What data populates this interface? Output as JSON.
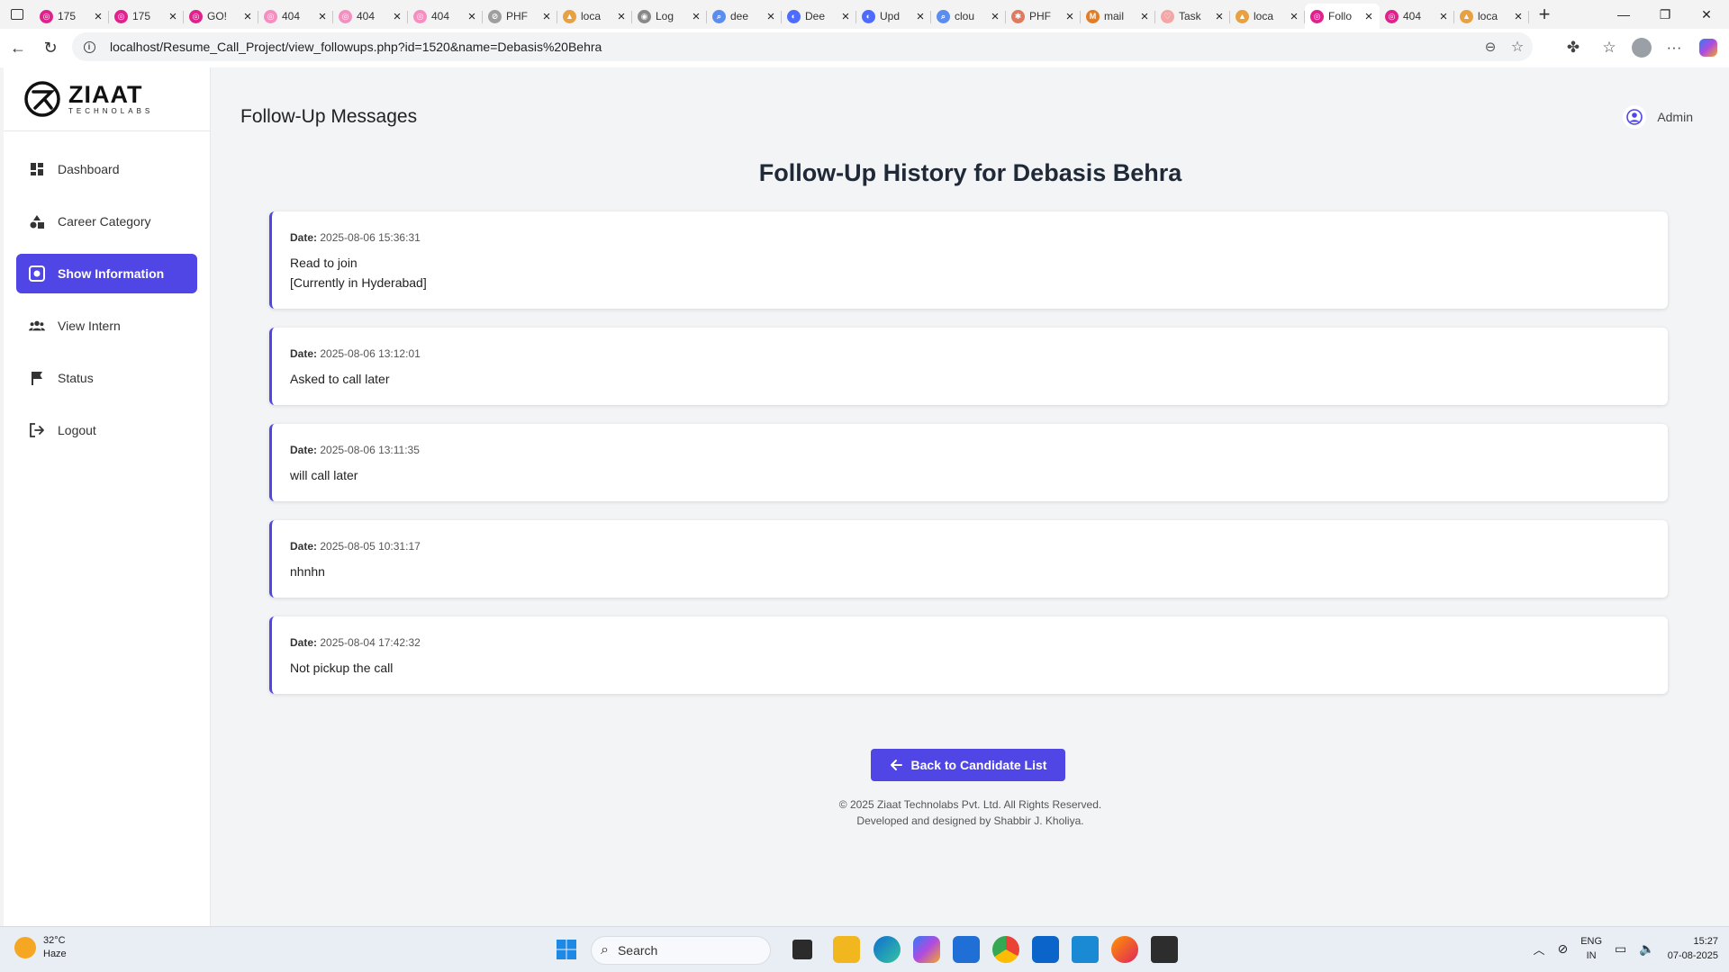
{
  "browser": {
    "tabs": [
      {
        "title": "175",
        "color": "#e0238c",
        "glyph": "◎"
      },
      {
        "title": "175",
        "color": "#e0238c",
        "glyph": "◎"
      },
      {
        "title": "GO!",
        "color": "#e0238c",
        "glyph": "◎"
      },
      {
        "title": "404",
        "color": "#f48fc0",
        "glyph": "◎"
      },
      {
        "title": "404",
        "color": "#f48fc0",
        "glyph": "◎"
      },
      {
        "title": "404",
        "color": "#f48fc0",
        "glyph": "◎"
      },
      {
        "title": "PHF",
        "color": "#9e9e9e",
        "glyph": "⊘"
      },
      {
        "title": "loca",
        "color": "#e8a040",
        "glyph": "▲"
      },
      {
        "title": "Log",
        "color": "#888888",
        "glyph": "◉"
      },
      {
        "title": "dee",
        "color": "#5b8def",
        "glyph": "⌕"
      },
      {
        "title": "Dee",
        "color": "#4d6bfe",
        "glyph": "◐"
      },
      {
        "title": "Upd",
        "color": "#4d6bfe",
        "glyph": "◐"
      },
      {
        "title": "clou",
        "color": "#5b8def",
        "glyph": "⌕"
      },
      {
        "title": "PHF",
        "color": "#e07a5f",
        "glyph": "✱"
      },
      {
        "title": "mail",
        "color": "#e57c1f",
        "glyph": "M"
      },
      {
        "title": "Task",
        "color": "#f4a6a6",
        "glyph": "♡"
      },
      {
        "title": "loca",
        "color": "#e8a040",
        "glyph": "▲"
      },
      {
        "title": "Follo",
        "color": "#e0238c",
        "glyph": "◎",
        "active": true
      },
      {
        "title": "404",
        "color": "#e0238c",
        "glyph": "◎"
      },
      {
        "title": "loca",
        "color": "#e8a040",
        "glyph": "▲"
      }
    ],
    "url": "localhost/Resume_Call_Project/view_followups.php?id=1520&name=Debasis%20Behra"
  },
  "sidebar": {
    "logo": {
      "name": "ZIAAT",
      "tagline": "TECHNOLABS"
    },
    "items": [
      {
        "label": "Dashboard",
        "icon": "dashboard-icon",
        "active": false
      },
      {
        "label": "Career Category",
        "icon": "shapes-icon",
        "active": false
      },
      {
        "label": "Show Information",
        "icon": "eye-icon",
        "active": true
      },
      {
        "label": "View Intern",
        "icon": "users-icon",
        "active": false
      },
      {
        "label": "Status",
        "icon": "flag-icon",
        "active": false
      },
      {
        "label": "Logout",
        "icon": "logout-icon",
        "active": false
      }
    ]
  },
  "header": {
    "page_title": "Follow-Up Messages",
    "user": "Admin"
  },
  "content": {
    "history_title": "Follow-Up History for Debasis Behra",
    "date_label": "Date:",
    "followups": [
      {
        "date": "2025-08-06 15:36:31",
        "message": "Read to join\n[Currently in Hyderabad]"
      },
      {
        "date": "2025-08-06 13:12:01",
        "message": "Asked to call later"
      },
      {
        "date": "2025-08-06 13:11:35",
        "message": "will call later"
      },
      {
        "date": "2025-08-05 10:31:17",
        "message": "nhnhn"
      },
      {
        "date": "2025-08-04 17:42:32",
        "message": "Not pickup the call"
      }
    ],
    "back_button": "Back to Candidate List",
    "footer_line1": "© 2025 Ziaat Technolabs Pvt. Ltd. All Rights Reserved.",
    "footer_line2": "Developed and designed by Shabbir J. Kholiya."
  },
  "taskbar": {
    "temperature": "32°C",
    "weather": "Haze",
    "search_placeholder": "Search",
    "lang_top": "ENG",
    "lang_bottom": "IN",
    "time": "15:27",
    "date": "07-08-2025"
  },
  "colors": {
    "accent": "#4f46e5",
    "card_bg": "#ffffff",
    "page_bg": "#f3f4f6"
  }
}
